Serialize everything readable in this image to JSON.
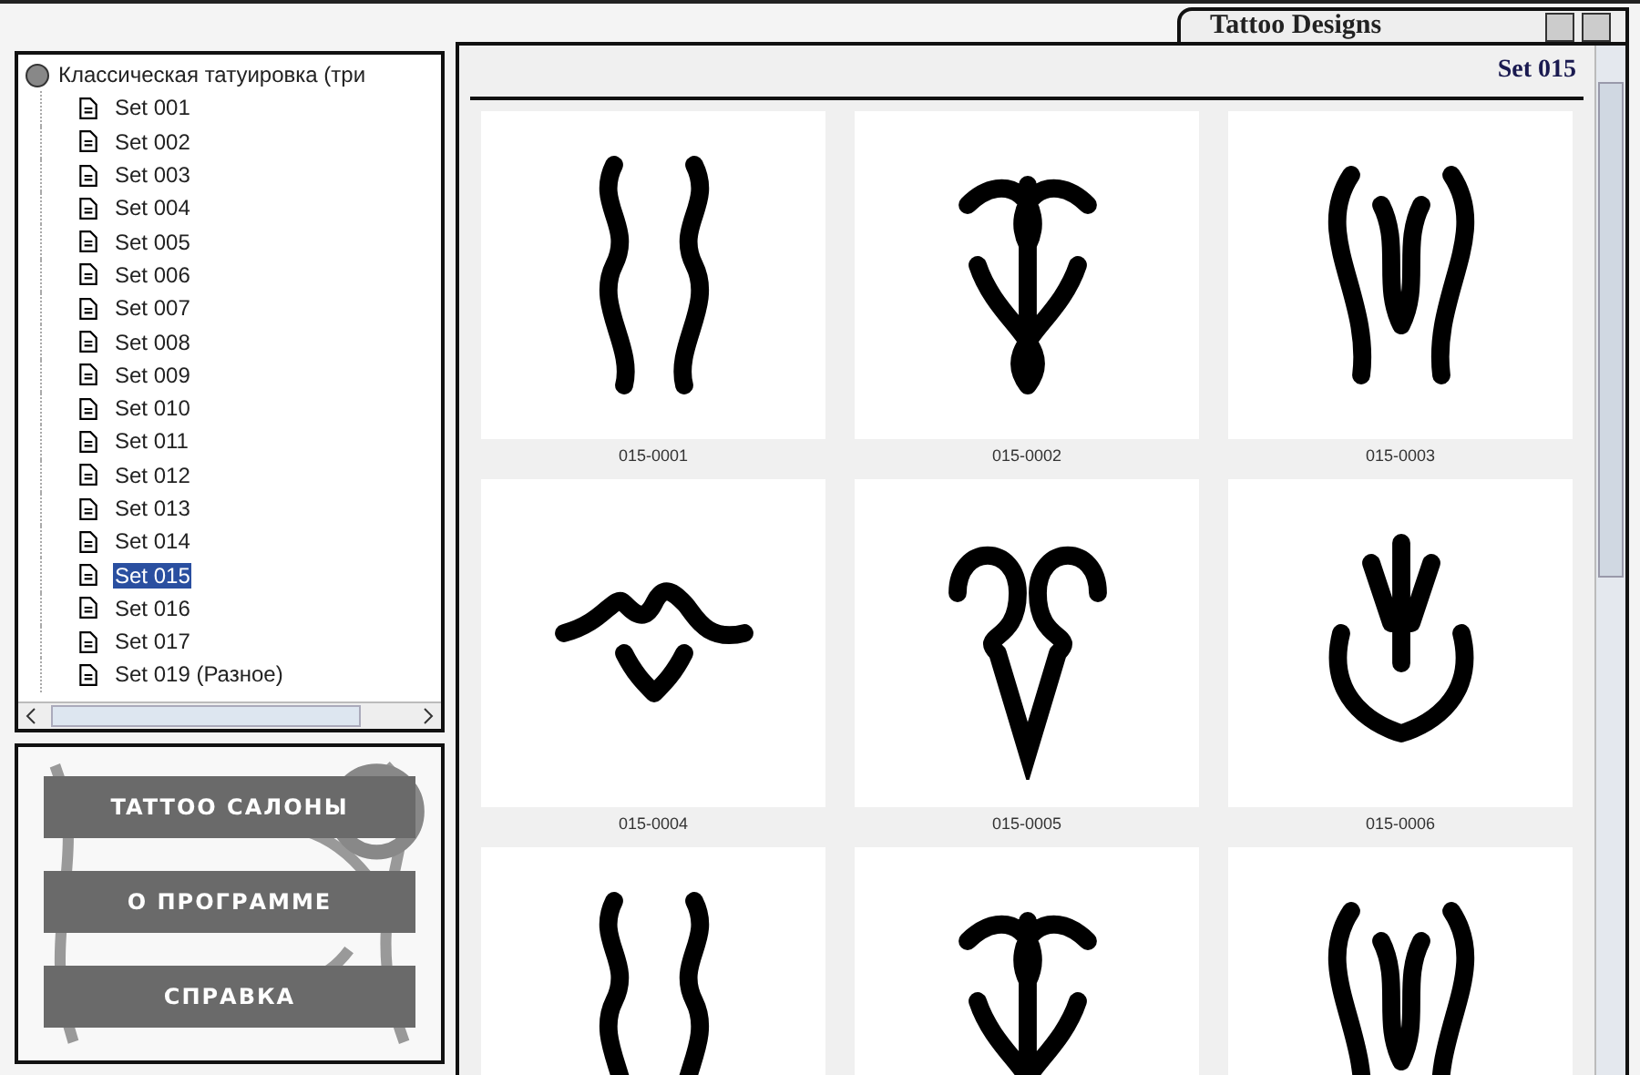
{
  "window": {
    "title": "Tattoo Designs"
  },
  "tree": {
    "label": "Классическая татуировка (три",
    "expanded": true,
    "children": [
      {
        "label": "Set 001",
        "selected": false
      },
      {
        "label": "Set 002",
        "selected": false
      },
      {
        "label": "Set 003",
        "selected": false
      },
      {
        "label": "Set 004",
        "selected": false
      },
      {
        "label": "Set 005",
        "selected": false
      },
      {
        "label": "Set 006",
        "selected": false
      },
      {
        "label": "Set 007",
        "selected": false
      },
      {
        "label": "Set 008",
        "selected": false
      },
      {
        "label": "Set 009",
        "selected": false
      },
      {
        "label": "Set 010",
        "selected": false
      },
      {
        "label": "Set 011",
        "selected": false
      },
      {
        "label": "Set 012",
        "selected": false
      },
      {
        "label": "Set 013",
        "selected": false
      },
      {
        "label": "Set 014",
        "selected": false
      },
      {
        "label": "Set 015",
        "selected": true
      },
      {
        "label": "Set 016",
        "selected": false
      },
      {
        "label": "Set 017",
        "selected": false
      },
      {
        "label": "Set 019 (Разное)",
        "selected": false
      }
    ]
  },
  "menu_buttons": [
    "TATTOO САЛОНЫ",
    "О ПРОГРАММЕ",
    "СПРАВКА"
  ],
  "gallery": {
    "heading": "Set 015",
    "items": [
      {
        "kind": "full",
        "caption": "015-0001"
      },
      {
        "kind": "full",
        "caption": "015-0002"
      },
      {
        "kind": "full",
        "caption": "015-0003"
      },
      {
        "kind": "full",
        "caption": "015-0004"
      },
      {
        "kind": "full",
        "caption": "015-0005"
      },
      {
        "kind": "full",
        "caption": "015-0006"
      },
      {
        "kind": "cut_off"
      },
      {
        "kind": "cut_off"
      },
      {
        "kind": "cut_off"
      }
    ]
  }
}
